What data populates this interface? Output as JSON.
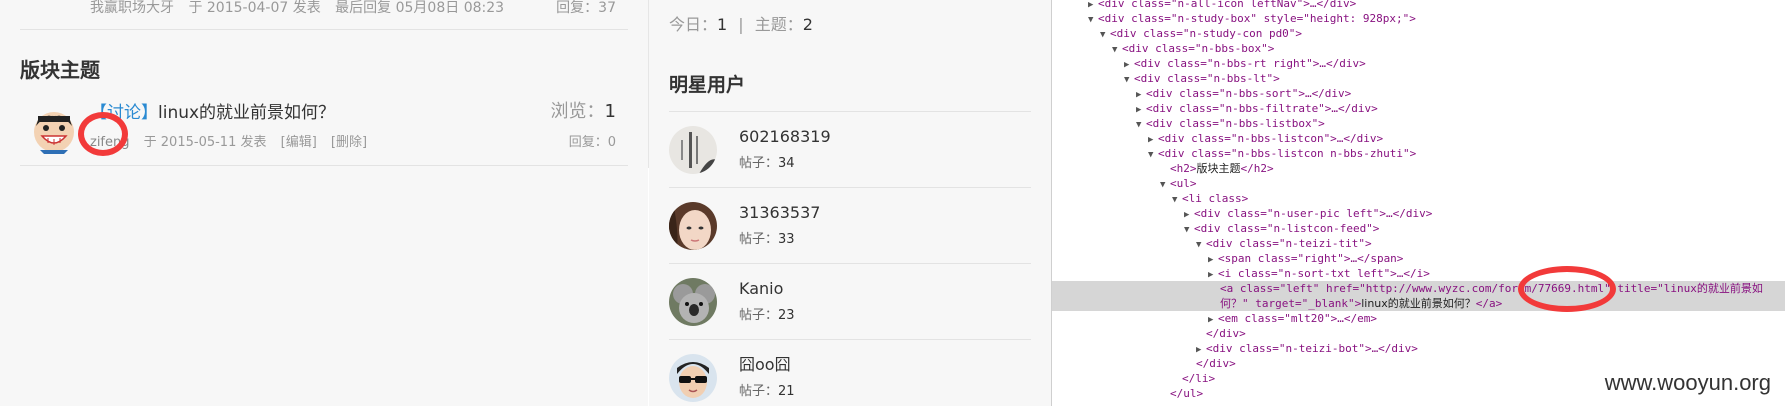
{
  "forum": {
    "top_row": {
      "author": "我赢职场大牙",
      "posted": "于 2015-04-07 发表",
      "last_reply": "最后回复 05月08日 08:23",
      "reply_label": "回复：",
      "reply_count": "37"
    },
    "section_title": "版块主题",
    "topic": {
      "category": "【讨论】",
      "title": "linux的就业前景如何？",
      "views_label": "浏览：",
      "views": "1",
      "author": "zifeng",
      "posted": "于 2015-05-11 发表",
      "edit": "[编辑]",
      "delete": "[删除]",
      "reply_label": "回复：",
      "reply_count": "0"
    }
  },
  "sidebar": {
    "today_label": "今日：",
    "today": "1",
    "separator": "|",
    "topics_label": "主题：",
    "topics": "2",
    "stars_title": "明星用户",
    "posts_label": "帖子：",
    "users": [
      {
        "name": "602168319",
        "posts": "34"
      },
      {
        "name": "31363537",
        "posts": "33"
      },
      {
        "name": "Kanio",
        "posts": "23"
      },
      {
        "name": "囧oo囧",
        "posts": "21"
      }
    ]
  },
  "devtools": {
    "lines": [
      {
        "indent": 0,
        "tri": "▶",
        "html": "<span class='tn'>&lt;div</span> <span class='an'>class</span>=<span class='av'>\"n-all-icon leftNav\"</span><span class='tn'>&gt;</span>…<span class='tn'>&lt;/div&gt;</span>"
      }
    ],
    "l1": "<div class=\"n-all-icon leftNav\">…</div>",
    "l2": "<div class=\"n-study-box\" style=\"height: 928px;\">",
    "l3": "<div class=\"n-study-con pd0\">",
    "l4": "<div class=\"n-bbs-box\">",
    "l5": "<div class=\"n-bbs-rt right\">…</div>",
    "l6": "<div class=\"n-bbs-lt\">",
    "l7": "<div class=\"n-bbs-sort\">…</div>",
    "l8": "<div class=\"n-bbs-filtrate\">…</div>",
    "l9": "<div class=\"n-bbs-listbox\">",
    "l10": "<div class=\"n-bbs-listcon\">…</div>",
    "l11": "<div class=\"n-bbs-listcon n-bbs-zhuti\">",
    "l12_open": "<h2>",
    "l12_text": "版块主题",
    "l12_close": "</h2>",
    "l13": "<ul>",
    "l14": "<li class>",
    "l15": "<div class=\"n-user-pic left\">…</div>",
    "l16": "<div class=\"n-listcon-feed\">",
    "l17": "<div class=\"n-teizi-tit\">",
    "l18": "<span class=\"right\">…</span>",
    "l19": "<i class=\"n-sort-txt left\">…</i>",
    "l20": "<a class=\"left\" href=\"http://www.wyzc.com/forum/77669.html\" title=\"linux的就业前景如",
    "l21_a": "何？\" target=\"_blank\">",
    "l21_text": "linux的就业前景如何？",
    "l21_b": "</a>",
    "l22": "<em class=\"mlt20\">…</em>",
    "l23": "</div>",
    "l24": "<div class=\"n-teizi-bot\">…</div>",
    "l25": "</div>",
    "l26": "</li>",
    "l27": "</ul>",
    "watermark": "www.wooyun.org"
  }
}
